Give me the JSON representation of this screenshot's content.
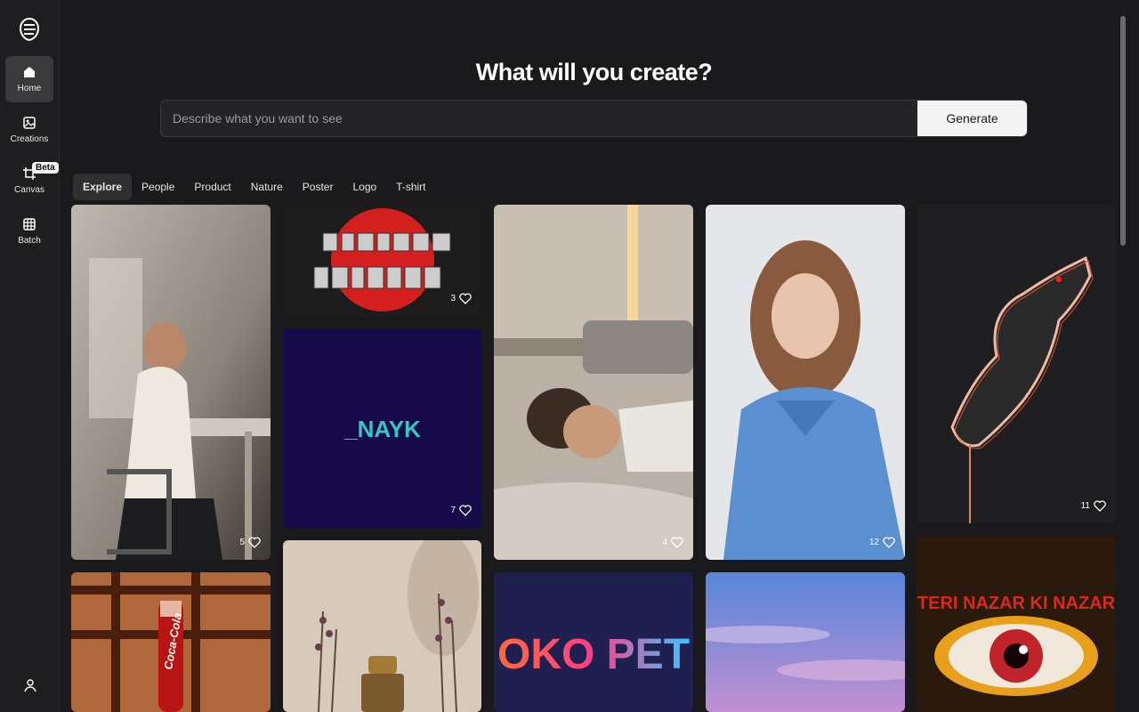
{
  "sidebar": {
    "items": [
      {
        "label": "Home",
        "icon": "home-icon"
      },
      {
        "label": "Creations",
        "icon": "image-icon"
      },
      {
        "label": "Canvas",
        "icon": "crop-icon",
        "badge": "Beta"
      },
      {
        "label": "Batch",
        "icon": "grid-icon"
      }
    ],
    "user_icon": "user-icon"
  },
  "header": {
    "title": "What will you create?"
  },
  "search": {
    "placeholder": "Describe what you want to see",
    "value": "",
    "button_label": "Generate"
  },
  "tabs": [
    "Explore",
    "People",
    "Product",
    "Nature",
    "Poster",
    "Logo",
    "T-shirt"
  ],
  "active_tab": "Explore",
  "gallery": {
    "cards": [
      {
        "subject": "man sitting by window",
        "likes": "5"
      },
      {
        "subject": "red circle logo",
        "likes": "3"
      },
      {
        "subject": "NAYK logo",
        "text": "_NAYK",
        "likes": "7"
      },
      {
        "subject": "boy lying in bed",
        "likes": "4"
      },
      {
        "subject": "woman in blue coat",
        "likes": "12"
      },
      {
        "subject": "glowing wolf",
        "likes": "11"
      },
      {
        "subject": "coca-cola bottle",
        "text": "Coca-Cola"
      },
      {
        "subject": "perfume bottle with flowers"
      },
      {
        "subject": "OKO PET logo",
        "text": "OKO PET"
      },
      {
        "subject": "purple sky"
      },
      {
        "subject": "eye poster",
        "text": "TERI NAZAR KI NAZAR"
      }
    ]
  },
  "colors": {
    "background": "#1a1a1c",
    "sidebar": "#1e1e20",
    "accent_red": "#d41f1f",
    "nayk_teal": "#36c6c4"
  }
}
